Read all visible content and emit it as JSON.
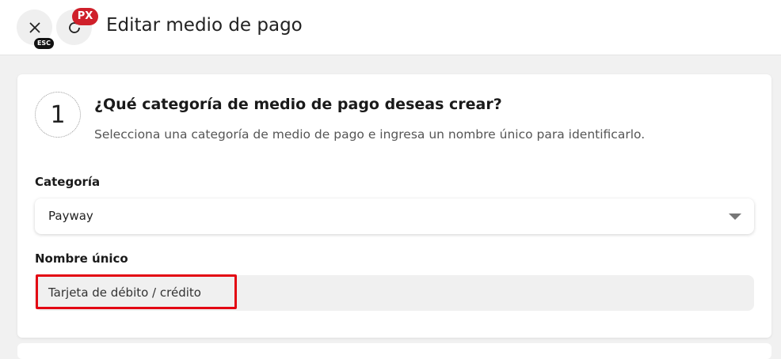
{
  "header": {
    "title": "Editar medio de pago",
    "close_icon": "close-icon",
    "esc_badge": "ESC",
    "refresh_icon": "refresh-icon",
    "px_badge": "PX"
  },
  "step": {
    "number": "1",
    "title": "¿Qué categoría de medio de pago deseas crear?",
    "subtitle": "Selecciona una categoría de medio de pago e ingresa un nombre único para identificarlo."
  },
  "form": {
    "category_label": "Categoría",
    "category_value": "Payway",
    "name_label": "Nombre único",
    "name_value": "Tarjeta de débito / crédito"
  },
  "colors": {
    "highlight": "#e30613",
    "badge_red": "#cf1f2a"
  }
}
